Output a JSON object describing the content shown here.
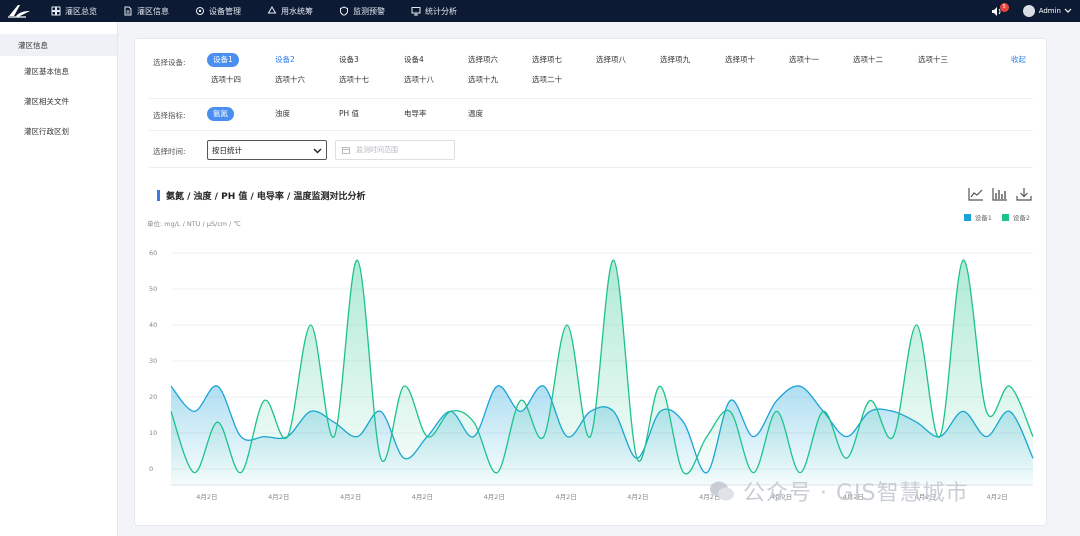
{
  "nav": [
    {
      "label": "灌区总览",
      "icon": "grid-icon"
    },
    {
      "label": "灌区信息",
      "icon": "document-icon"
    },
    {
      "label": "设备管理",
      "icon": "gear-icon"
    },
    {
      "label": "用水统筹",
      "icon": "recycle-icon"
    },
    {
      "label": "监测预警",
      "icon": "shield-icon"
    },
    {
      "label": "统计分析",
      "icon": "monitor-icon"
    }
  ],
  "top_right": {
    "badge": "5",
    "user": "Admin"
  },
  "sidebar": {
    "header": "灌区信息",
    "items": [
      "灌区基本信息",
      "灌区相关文件",
      "灌区行政区划"
    ]
  },
  "filters": {
    "device_label": "选择设备:",
    "devices_row1": [
      "设备1",
      "设备2",
      "设备3",
      "设备4",
      "选择项六",
      "选择项七",
      "选择项八",
      "选择项九",
      "选择项十",
      "选项十一",
      "选项十二",
      "选项十三"
    ],
    "devices_row2": [
      "选项十四",
      "选项十六",
      "选项十七",
      "选项十八",
      "选项十九",
      "选项二十"
    ],
    "collapse": "收起",
    "indicator_label": "选择指标:",
    "indicators": [
      "氨氮",
      "浊度",
      "PH 值",
      "电导率",
      "温度"
    ],
    "time_label": "选择时间:",
    "time_select": "按日统计",
    "date_placeholder": "监测时间范围"
  },
  "chart_data": {
    "type": "area",
    "title": "氨氮 / 浊度 / PH 值 / 电导率 / 温度监测对比分析",
    "unit_label": "单位: mg/L / NTU / μS/cm / ℃",
    "x_tick_labels": [
      "4月2日",
      "4月2日",
      "4月2日",
      "4月2日",
      "4月2日",
      "4月2日",
      "4月2日",
      "4月2日",
      "4月2日",
      "4月2日",
      "4月2日",
      "4月2日"
    ],
    "y_ticks": [
      0,
      10,
      20,
      30,
      40,
      50,
      60
    ],
    "ylim": [
      0,
      60
    ],
    "legend_position": "top-right",
    "series": [
      {
        "name": "设备1",
        "color": "#1aa3d8",
        "values": [
          23,
          16,
          23,
          9,
          9,
          9,
          16,
          13,
          9,
          16,
          3,
          9,
          16,
          9,
          23,
          16,
          23,
          9,
          16,
          16,
          3,
          16,
          13,
          -1,
          19,
          9,
          19,
          23,
          16,
          9,
          16,
          16,
          13,
          9,
          16,
          9,
          16,
          3
        ]
      },
      {
        "name": "设备2",
        "color": "#1dc28b",
        "values": [
          16,
          -1,
          13,
          -1,
          19,
          9,
          40,
          9,
          58,
          3,
          23,
          9,
          16,
          13,
          -1,
          19,
          9,
          40,
          9,
          58,
          3,
          23,
          -1,
          9,
          16,
          -1,
          16,
          -1,
          16,
          3,
          19,
          9,
          40,
          9,
          58,
          16,
          23,
          9
        ]
      }
    ]
  },
  "toolbar_icons": [
    "line-chart-icon",
    "bar-chart-icon",
    "download-icon"
  ],
  "watermark": "公众号 · GIS智慧城市"
}
